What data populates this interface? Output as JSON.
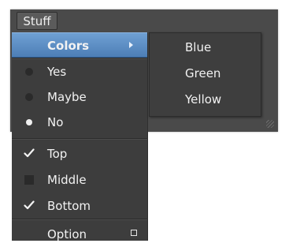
{
  "menubar": {
    "title": "Stuff"
  },
  "menu": {
    "items": [
      {
        "type": "submenu",
        "label": "Colors",
        "active": true,
        "icon": "chevron-right-icon"
      },
      {
        "type": "radio",
        "label": "Yes",
        "selected": false
      },
      {
        "type": "radio",
        "label": "Maybe",
        "selected": false
      },
      {
        "type": "radio",
        "label": "No",
        "selected": true
      },
      {
        "type": "check",
        "label": "Top",
        "checked": true
      },
      {
        "type": "check",
        "label": "Middle",
        "checked": false
      },
      {
        "type": "check",
        "label": "Bottom",
        "checked": true
      },
      {
        "type": "option",
        "label": "Option",
        "icon": "option-box-icon"
      }
    ]
  },
  "submenu": {
    "items": [
      {
        "label": "Blue"
      },
      {
        "label": "Green"
      },
      {
        "label": "Yellow"
      }
    ]
  },
  "colors": {
    "window_bg": "#4a4a4a",
    "menu_bg": "#3d3d3d",
    "highlight": "#5d8fc6",
    "text": "#f2f2f2"
  }
}
